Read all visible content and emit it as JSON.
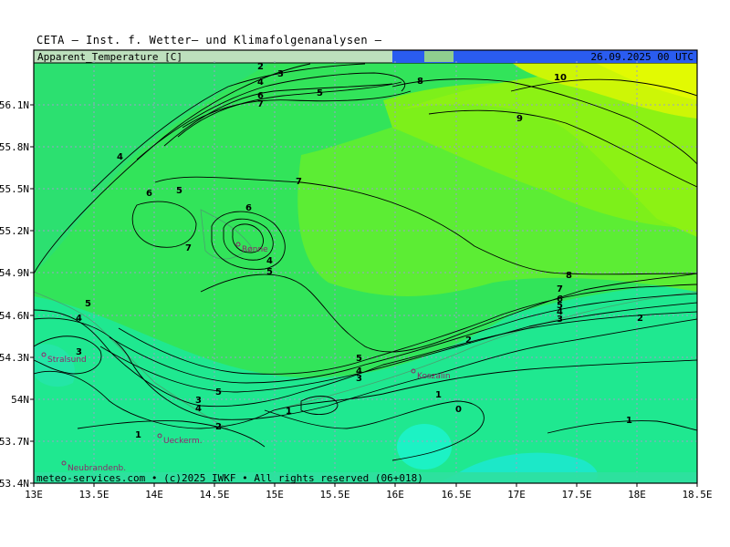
{
  "header": {
    "title": "CETA — Inst. f. Wetter— und Klimafolgenanalysen —"
  },
  "map": {
    "variable": "Apparent_Temperature",
    "unit": "[C]",
    "datetime": "26.09.2025 00 UTC",
    "footer": "meteo-services.com • (c)2025 IWKF • All rights reserved (06+018)",
    "lat_ticks": [
      "56.1N",
      "55.8N",
      "55.5N",
      "55.2N",
      "54.9N",
      "54.6N",
      "54.3N",
      "54N",
      "53.7N",
      "53.4N"
    ],
    "lon_ticks": [
      "13E",
      "13.5E",
      "14E",
      "14.5E",
      "15E",
      "15.5E",
      "16E",
      "16.5E",
      "17E",
      "17.5E",
      "18E",
      "18.5E"
    ],
    "cities": [
      {
        "name": "Rønne"
      },
      {
        "name": "Stralsund"
      },
      {
        "name": "Koszalin"
      },
      {
        "name": "Ueckerm."
      },
      {
        "name": "Neubrandenb."
      }
    ],
    "contour_labels": [
      "2",
      "3",
      "4",
      "6",
      "7",
      "5",
      "8",
      "10",
      "9",
      "4",
      "6",
      "5",
      "7",
      "6",
      "4",
      "5",
      "7",
      "8",
      "7",
      "6",
      "5",
      "4",
      "3",
      "2",
      "5",
      "4",
      "3",
      "2",
      "3",
      "5",
      "4",
      "3",
      "5",
      "4",
      "3",
      "2",
      "1",
      "1",
      "0",
      "1",
      "1"
    ]
  }
}
